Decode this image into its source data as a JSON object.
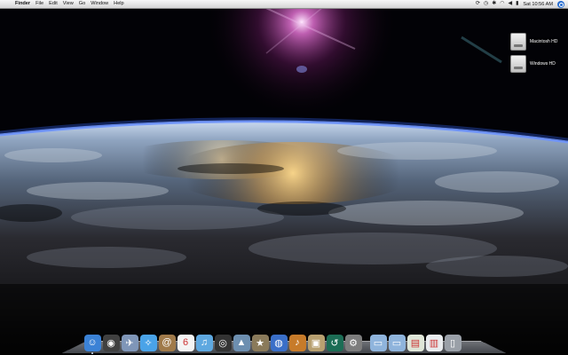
{
  "menubar": {
    "apple_glyph": "",
    "app_name": "Finder",
    "menus": [
      "File",
      "Edit",
      "View",
      "Go",
      "Window",
      "Help"
    ],
    "status_icons": [
      "sync-icon",
      "timemachine-icon",
      "bluetooth-icon",
      "wifi-icon",
      "volume-icon",
      "flag-icon"
    ],
    "status_glyphs": [
      "⟳",
      "◷",
      "✱",
      "◠",
      "◀",
      "▮"
    ],
    "clock": "Sat 10:56 AM"
  },
  "desktop": {
    "disks": [
      {
        "label": "Macintosh HD"
      },
      {
        "label": "Windows HD"
      }
    ]
  },
  "dock": {
    "items": [
      {
        "name": "finder-icon",
        "glyph": "☺",
        "bg": "#3b82d6",
        "running": true
      },
      {
        "name": "dashboard-icon",
        "glyph": "◉",
        "bg": "#404040",
        "running": false
      },
      {
        "name": "mail-icon",
        "glyph": "✈",
        "bg": "#7f96b8",
        "running": false
      },
      {
        "name": "safari-icon",
        "glyph": "✧",
        "bg": "#4aa3e8",
        "running": false
      },
      {
        "name": "address-book-icon",
        "glyph": "@",
        "bg": "#a07a4a",
        "running": false
      },
      {
        "name": "ical-icon",
        "glyph": "6",
        "bg": "#f4f4f4",
        "running": false
      },
      {
        "name": "itunes-icon",
        "glyph": "♫",
        "bg": "#5ea8e0",
        "running": false
      },
      {
        "name": "photo-booth-icon",
        "glyph": "◎",
        "bg": "#333",
        "running": false
      },
      {
        "name": "iphoto-icon",
        "glyph": "▲",
        "bg": "#6d8fb0",
        "running": false
      },
      {
        "name": "imovie-icon",
        "glyph": "★",
        "bg": "#8a7a5a",
        "running": false
      },
      {
        "name": "idvd-icon",
        "glyph": "◍",
        "bg": "#3a6fc8",
        "running": false
      },
      {
        "name": "garageband-icon",
        "glyph": "♪",
        "bg": "#c77b2a",
        "running": false
      },
      {
        "name": "preview-icon",
        "glyph": "▣",
        "bg": "#b8a070",
        "running": false
      },
      {
        "name": "time-machine-icon",
        "glyph": "↺",
        "bg": "#1c6d55",
        "running": false
      },
      {
        "name": "system-preferences-icon",
        "glyph": "⚙",
        "bg": "#7d7d7d",
        "running": false
      },
      {
        "separator": true
      },
      {
        "name": "applications-folder-icon",
        "glyph": "▭",
        "bg": "#8fb4dc",
        "running": false
      },
      {
        "name": "documents-folder-icon",
        "glyph": "▭",
        "bg": "#8fb4dc",
        "running": false
      },
      {
        "name": "downloads-stack-icon",
        "glyph": "▤",
        "bg": "#dfe6d8",
        "running": false
      },
      {
        "name": "documents-stack-icon",
        "glyph": "▥",
        "bg": "#e9ecef",
        "running": false
      },
      {
        "name": "trash-icon",
        "glyph": "▯",
        "bg": "#9aa0a8",
        "running": false
      }
    ]
  }
}
